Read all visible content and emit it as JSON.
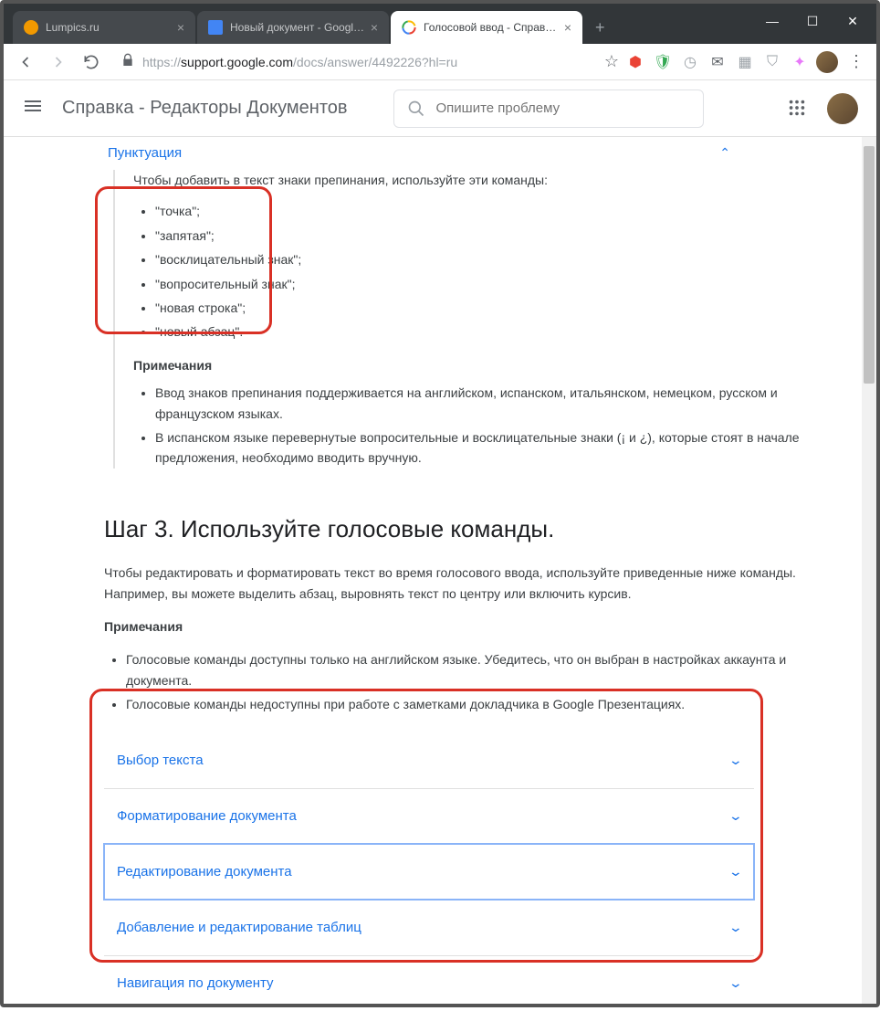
{
  "window": {
    "tabs": [
      {
        "title": "Lumpics.ru",
        "favicon_color": "#f29900"
      },
      {
        "title": "Новый документ - Google Д",
        "favicon_color": "#4285f4"
      },
      {
        "title": "Голосовой ввод - Справка -",
        "favicon_color": "#ffffff"
      }
    ],
    "controls": {
      "min": "—",
      "max": "☐",
      "close": "✕"
    }
  },
  "addressbar": {
    "protocol": "https://",
    "host": "support.google.com",
    "path": "/docs/answer/4492226?hl=ru"
  },
  "header": {
    "title": "Справка - Редакторы Документов",
    "search_placeholder": "Опишите проблему"
  },
  "content": {
    "section_link": "Пунктуация",
    "intro": "Чтобы добавить в текст знаки препинания, используйте эти команды:",
    "punct_items": [
      "\"точка\";",
      "\"запятая\";",
      "\"восклицательный знак\";",
      "\"вопросительный знак\";",
      "\"новая строка\";",
      "\"новый абзац\"."
    ],
    "notes_heading": "Примечания",
    "notes": [
      "Ввод знаков препинания поддерживается на английском, испанском, итальянском, немецком, русском и французском языках.",
      "В испанском языке перевернутые вопросительные и восклицательные знаки (¡ и ¿), которые стоят в начале предложения, необходимо вводить вручную."
    ],
    "step_heading": "Шаг 3. Используйте голосовые команды.",
    "step_paragraph": "Чтобы редактировать и форматировать текст во время голосового ввода, используйте приведенные ниже команды. Например, вы можете выделить абзац, выровнять текст по центру или включить курсив.",
    "step_notes_heading": "Примечания",
    "step_notes": [
      "Голосовые команды доступны только на английском языке. Убедитесь, что он выбран в настройках аккаунта и документа.",
      "Голосовые команды недоступны при работе с заметками докладчика в Google Презентациях."
    ],
    "accordion": [
      "Выбор текста",
      "Форматирование документа",
      "Редактирование документа",
      "Добавление и редактирование таблиц",
      "Навигация по документу"
    ]
  }
}
